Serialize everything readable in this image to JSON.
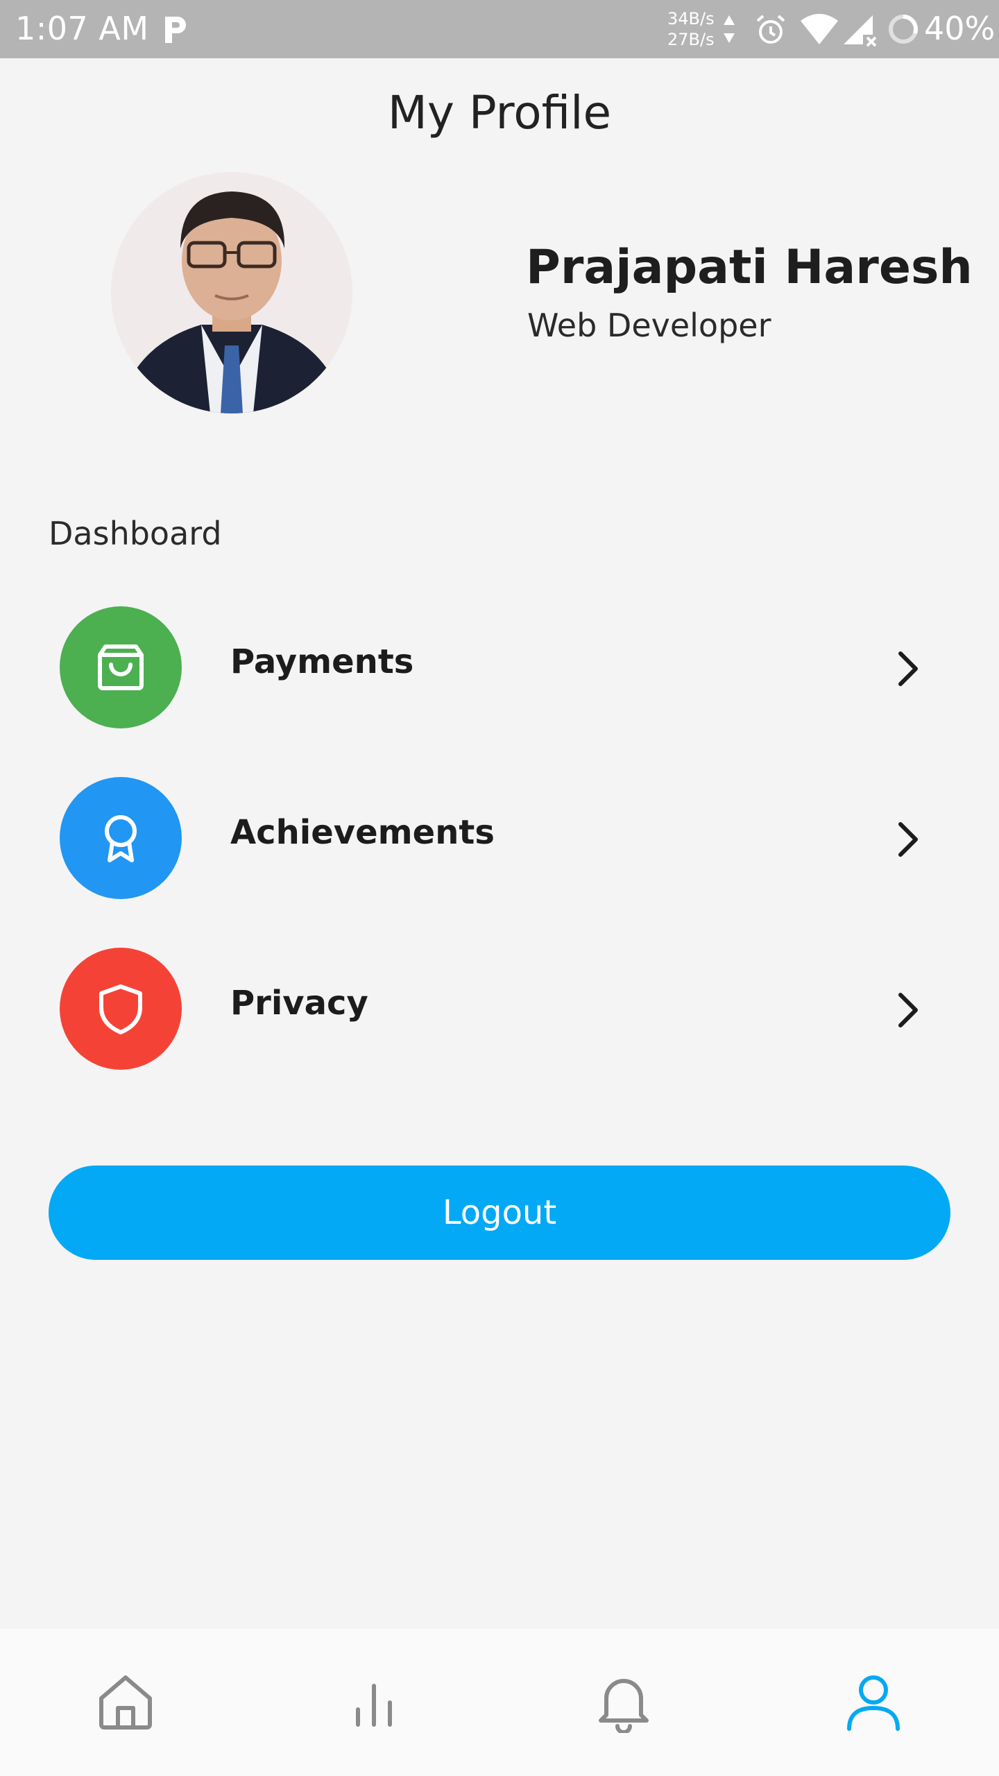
{
  "status_bar": {
    "time": "1:07 AM",
    "net_up": "34B/s",
    "net_down": "27B/s",
    "battery": "40%"
  },
  "header": {
    "title": "My Profile"
  },
  "profile": {
    "name": "Prajapati Haresh",
    "role": "Web Developer"
  },
  "dashboard": {
    "label": "Dashboard",
    "items": [
      {
        "label": "Payments",
        "icon": "shopping-bag-icon",
        "color": "#4caf50"
      },
      {
        "label": "Achievements",
        "icon": "award-icon",
        "color": "#2196f3"
      },
      {
        "label": "Privacy",
        "icon": "shield-icon",
        "color": "#f44336"
      }
    ]
  },
  "logout": {
    "label": "Logout",
    "color": "#03a9f4"
  },
  "bottom_nav": {
    "items": [
      {
        "icon": "home-icon"
      },
      {
        "icon": "bar-chart-icon"
      },
      {
        "icon": "bell-icon"
      },
      {
        "icon": "user-icon",
        "active": true
      }
    ],
    "active_color": "#03a9f4"
  }
}
